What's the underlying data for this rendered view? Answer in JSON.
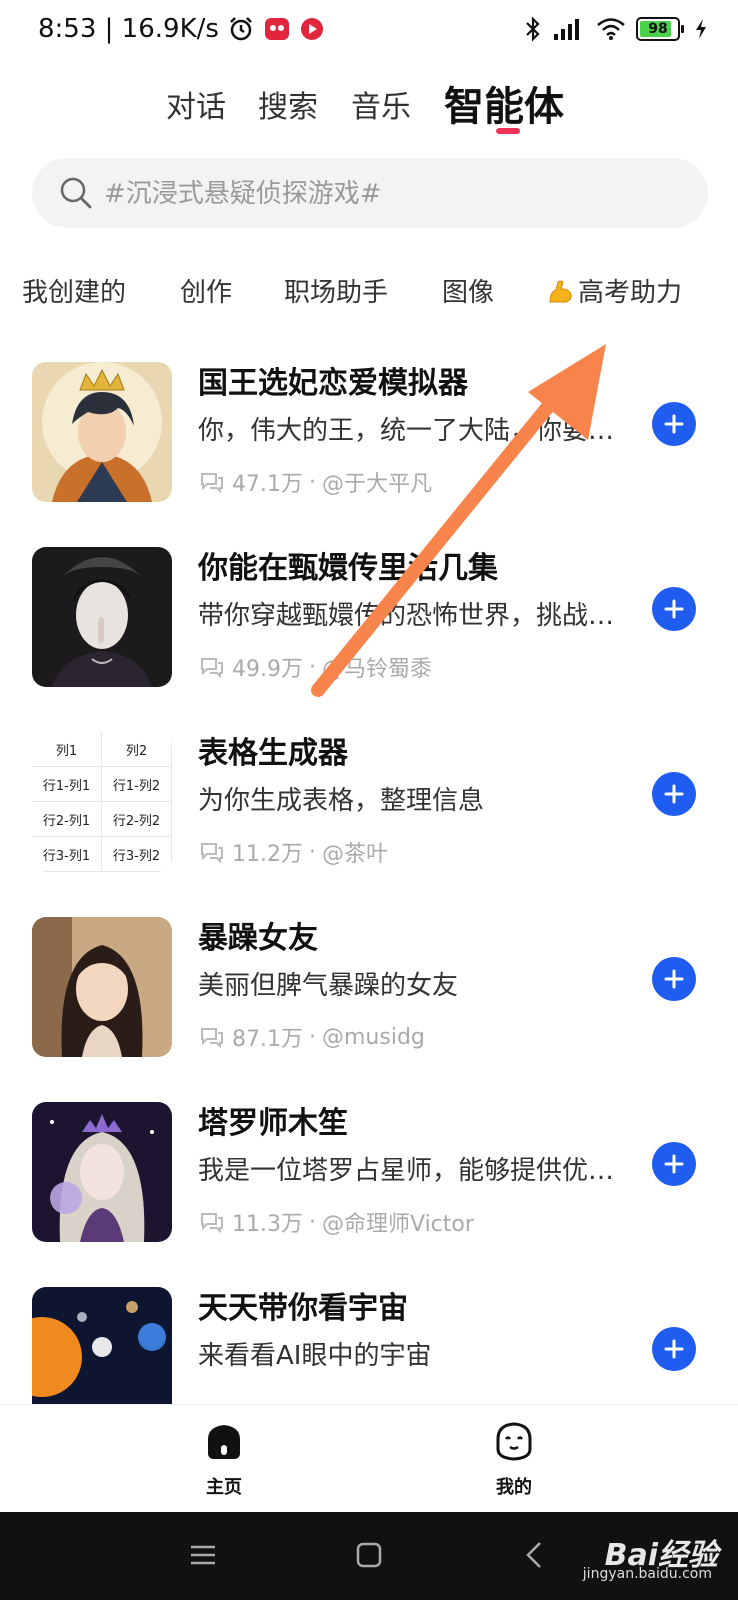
{
  "status_bar": {
    "time_speed": "8:53 | 16.9K/s",
    "battery": "98",
    "battery_level": 0.98
  },
  "top_tabs": [
    {
      "label": "对话",
      "active": false
    },
    {
      "label": "搜索",
      "active": false
    },
    {
      "label": "音乐",
      "active": false
    },
    {
      "label": "智能体",
      "active": true
    }
  ],
  "search": {
    "placeholder": "#沉浸式悬疑侦探游戏#"
  },
  "category_tabs": [
    {
      "label": "我创建的"
    },
    {
      "label": "创作"
    },
    {
      "label": "职场助手"
    },
    {
      "label": "图像"
    },
    {
      "label": "高考助力",
      "icon": "flexed-biceps-icon"
    }
  ],
  "agents": [
    {
      "title": "国王选妃恋爱模拟器",
      "desc": "你，伟大的王，统一了大陆，你要选出你的王妃…",
      "count": "47.1万",
      "author": "@于大平凡"
    },
    {
      "title": "你能在甄嬛传里活几集",
      "desc": "带你穿越甄嬛传的恐怖世界，挑战生存极限",
      "count": "49.9万",
      "author": "@马铃蜀黍"
    },
    {
      "title": "表格生成器",
      "desc": "为你生成表格，整理信息",
      "count": "11.2万",
      "author": "@茶叶",
      "table": [
        "列1",
        "列2",
        "行1-列1",
        "行1-列2",
        "行2-列1",
        "行2-列2",
        "行3-列1",
        "行3-列2"
      ]
    },
    {
      "title": "暴躁女友",
      "desc": "美丽但脾气暴躁的女友",
      "count": "87.1万",
      "author": "@musidg"
    },
    {
      "title": "塔罗师木笙",
      "desc": "我是一位塔罗占星师，能够提供优质的塔罗解读",
      "count": "11.3万",
      "author": "@命理师Victor"
    },
    {
      "title": "天天带你看宇宙",
      "desc": "来看看AI眼中的宇宙",
      "count": "",
      "author": ""
    }
  ],
  "bottom_nav": {
    "home_label": "主页",
    "mine_label": "我的"
  },
  "watermark": {
    "text": "Bai经验",
    "url": "jingyan.baidu.com"
  },
  "colors": {
    "accent_blue": "#1f5cf0",
    "tab_indicator": "#f2325b",
    "arrow": "#f7844a"
  }
}
